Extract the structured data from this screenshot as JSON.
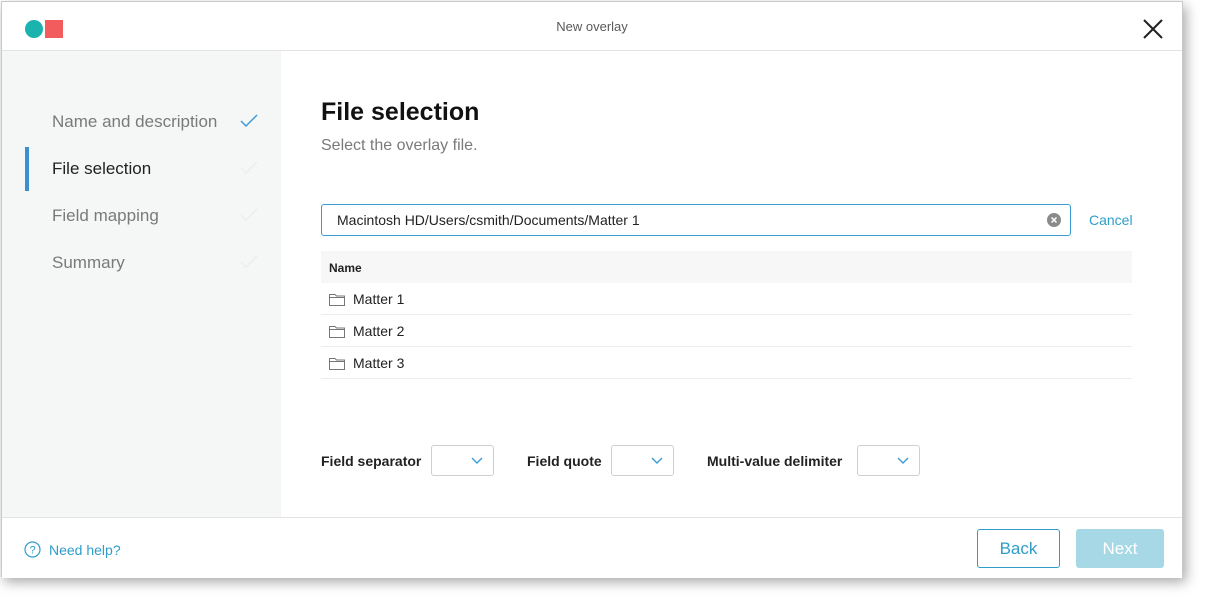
{
  "window": {
    "title": "New overlay"
  },
  "colors": {
    "accent": "#2f9dc9",
    "logo_teal": "#1bb3ad",
    "logo_red": "#f25c5c",
    "active_bar": "#3a8fd0",
    "next_disabled": "#a7d8e6"
  },
  "sidebar": {
    "steps": [
      {
        "label": "Name and description",
        "state": "done"
      },
      {
        "label": "File selection",
        "state": "active"
      },
      {
        "label": "Field mapping",
        "state": "pending"
      },
      {
        "label": "Summary",
        "state": "pending"
      }
    ]
  },
  "main": {
    "title": "File selection",
    "subtitle": "Select the overlay file.",
    "path_value": "Macintosh HD/Users/csmith/Documents/Matter 1",
    "cancel_label": "Cancel",
    "table": {
      "header": "Name",
      "rows": [
        {
          "name": "Matter 1",
          "icon": "folder-icon"
        },
        {
          "name": "Matter 2",
          "icon": "folder-icon"
        },
        {
          "name": "Matter 3",
          "icon": "folder-icon"
        }
      ]
    },
    "options": {
      "field_separator_label": "Field separator",
      "field_quote_label": "Field quote",
      "multi_value_delimiter_label": "Multi-value delimiter"
    }
  },
  "footer": {
    "help_label": "Need help?",
    "back_label": "Back",
    "next_label": "Next"
  }
}
